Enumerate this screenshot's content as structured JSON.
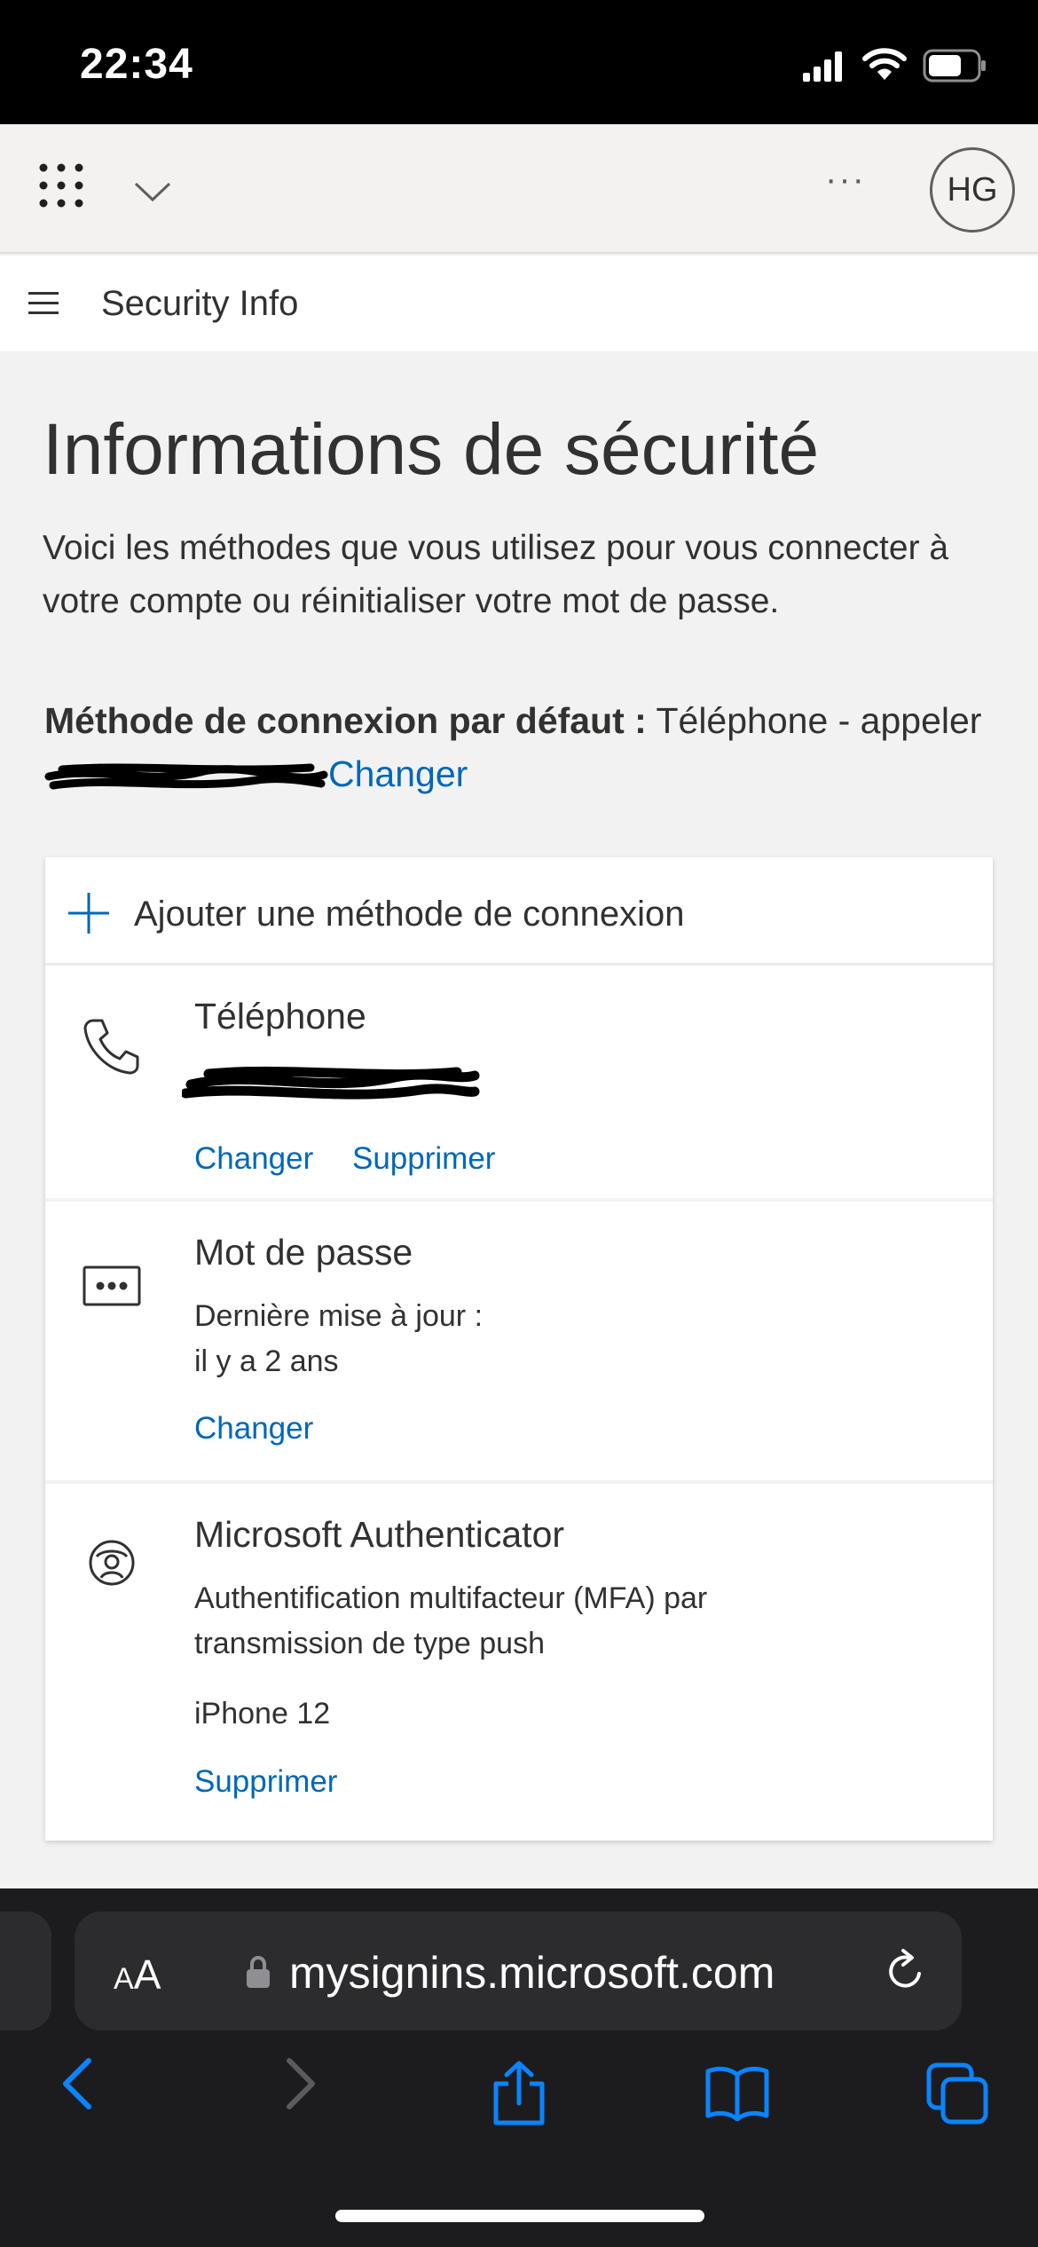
{
  "status_bar": {
    "time": "22:34"
  },
  "header": {
    "avatar_initials": "HG",
    "more": "···"
  },
  "nav": {
    "title": "Security Info"
  },
  "main": {
    "title": "Informations de sécurité",
    "intro": "Voici les méthodes que vous utilisez pour vous connecter à votre compte ou réinitialiser votre mot de passe.",
    "default_method": {
      "label": "Méthode de connexion par défaut :",
      "value": " Téléphone - appeler ",
      "change_link": "Changer"
    }
  },
  "card": {
    "add_label": "Ajouter une méthode de connexion",
    "methods": [
      {
        "title": "Téléphone",
        "icon": "phone-icon",
        "links": [
          "Changer",
          "Supprimer"
        ]
      },
      {
        "title": "Mot de passe",
        "icon": "password-icon",
        "detail_line1": "Dernière mise à jour :",
        "detail_line2": "il y a 2 ans",
        "links": [
          "Changer"
        ]
      },
      {
        "title": "Microsoft Authenticator",
        "icon": "authenticator-icon",
        "detail_line1": "Authentification multifacteur (MFA) par",
        "detail_line2": "transmission de type push",
        "device": "iPhone 12",
        "links": [
          "Supprimer"
        ]
      }
    ]
  },
  "safari": {
    "aa_label_small": "A",
    "aa_label": "A",
    "url": "mysignins.microsoft.com"
  },
  "colors": {
    "link": "#0067b8",
    "text": "#323130",
    "background": "#f2f2f2"
  }
}
